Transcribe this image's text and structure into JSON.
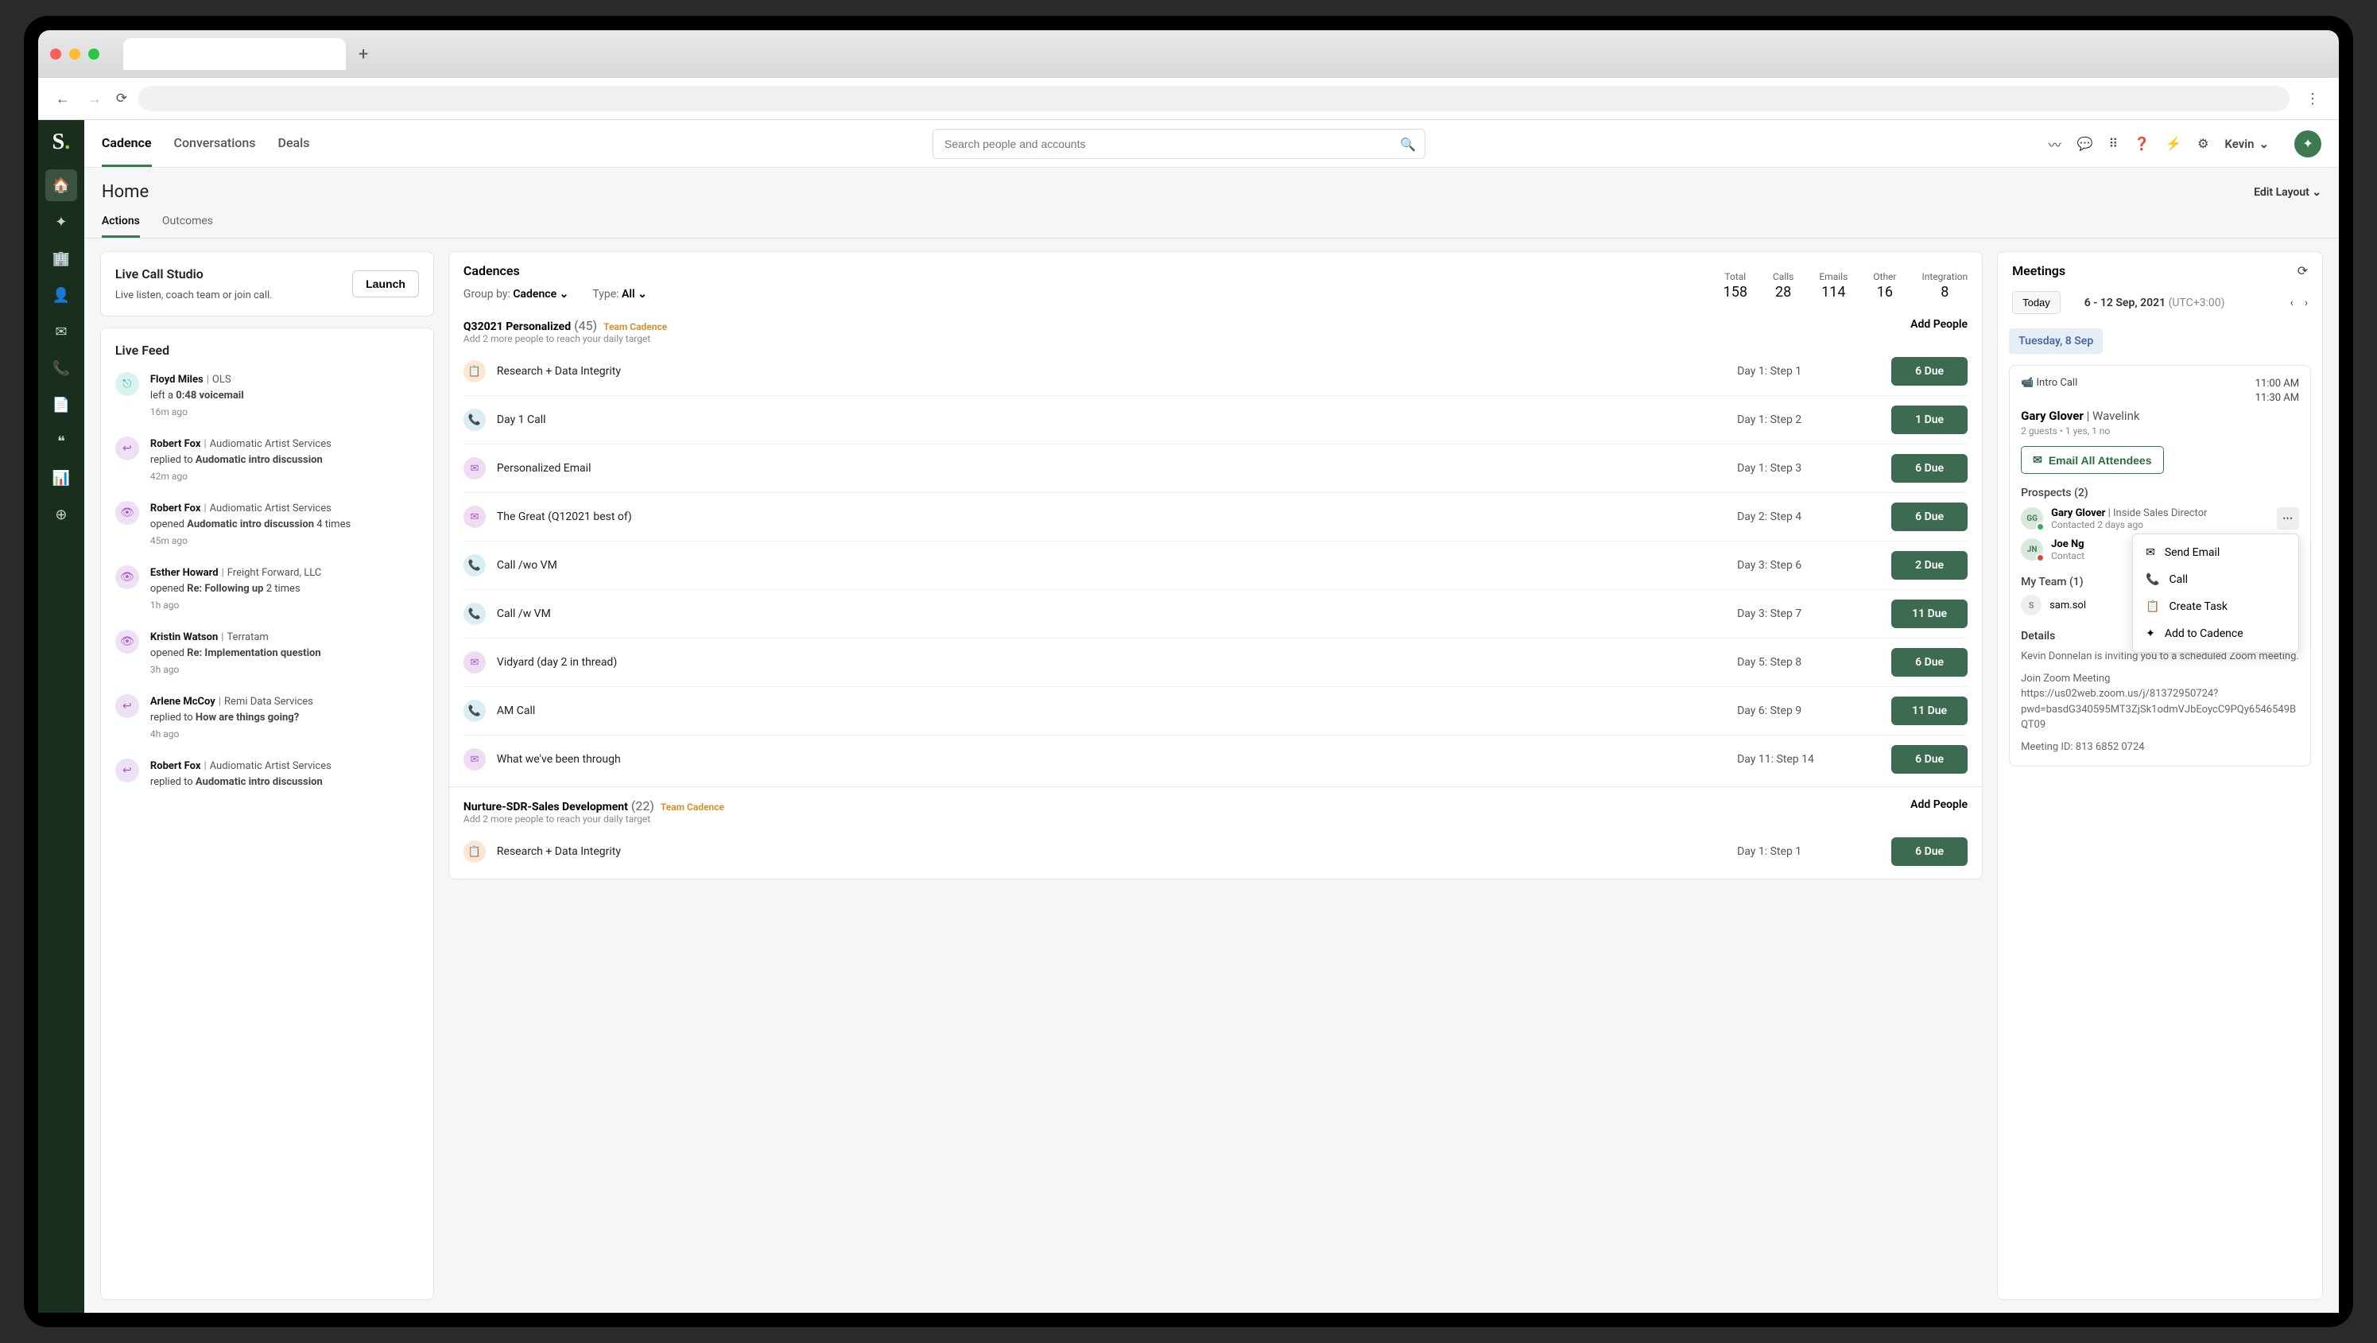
{
  "browser": {
    "new_tab": "+"
  },
  "topNav": {
    "items": [
      "Cadence",
      "Conversations",
      "Deals"
    ],
    "activeIndex": 0
  },
  "search": {
    "placeholder": "Search people and accounts"
  },
  "user": {
    "name": "Kevin"
  },
  "page": {
    "title": "Home",
    "editLayout": "Edit Layout"
  },
  "tabs": {
    "items": [
      "Actions",
      "Outcomes"
    ],
    "activeIndex": 0
  },
  "liveCall": {
    "title": "Live Call Studio",
    "sub": "Live listen, coach team or join call.",
    "button": "Launch"
  },
  "liveFeed": {
    "title": "Live Feed",
    "items": [
      {
        "icon": "voicemail",
        "name": "Floyd Miles",
        "company": "OLS",
        "action": "left a",
        "bold": "0:48 voicemail",
        "suffix": "",
        "time": "16m ago"
      },
      {
        "icon": "reply",
        "name": "Robert Fox",
        "company": "Audiomatic Artist Services",
        "action": "replied to",
        "bold": "Audomatic intro discussion",
        "suffix": "",
        "time": "42m ago"
      },
      {
        "icon": "view",
        "name": "Robert Fox",
        "company": "Audiomatic Artist Services",
        "action": "opened",
        "bold": "Audomatic intro discussion",
        "suffix": " 4 times",
        "time": "45m ago"
      },
      {
        "icon": "view",
        "name": "Esther Howard",
        "company": "Freight Forward, LLC",
        "action": "opened",
        "bold": "Re: Following up",
        "suffix": " 2 times",
        "time": "1h ago"
      },
      {
        "icon": "view",
        "name": "Kristin Watson",
        "company": "Terratam",
        "action": "opened",
        "bold": "Re: Implementation question",
        "suffix": "",
        "time": "3h ago"
      },
      {
        "icon": "reply",
        "name": "Arlene McCoy",
        "company": "Remi Data Services",
        "action": "replied to",
        "bold": "How are things going?",
        "suffix": "",
        "time": "4h ago"
      },
      {
        "icon": "reply",
        "name": "Robert Fox",
        "company": "Audiomatic Artist Services",
        "action": "replied to",
        "bold": "Audomatic intro discussion",
        "suffix": "",
        "time": ""
      }
    ]
  },
  "cadences": {
    "title": "Cadences",
    "groupBy": {
      "label": "Group by:",
      "value": "Cadence"
    },
    "type": {
      "label": "Type:",
      "value": "All"
    },
    "stats": [
      {
        "label": "Total",
        "value": "158"
      },
      {
        "label": "Calls",
        "value": "28"
      },
      {
        "label": "Emails",
        "value": "114"
      },
      {
        "label": "Other",
        "value": "16"
      },
      {
        "label": "Integration",
        "value": "8"
      }
    ],
    "groups": [
      {
        "name": "Q32021 Personalized",
        "count": "(45)",
        "tag": "Team Cadence",
        "sub": "Add 2 more people to reach your daily target",
        "addPeople": "Add People",
        "steps": [
          {
            "type": "action",
            "name": "Research + Data Integrity",
            "day": "Day 1: Step 1",
            "due": "6 Due"
          },
          {
            "type": "call",
            "name": "Day 1 Call",
            "day": "Day 1: Step 2",
            "due": "1 Due"
          },
          {
            "type": "email",
            "name": "Personalized Email",
            "day": "Day 1: Step 3",
            "due": "6 Due"
          },
          {
            "type": "email",
            "name": "The Great (Q12021 best of)",
            "day": "Day 2: Step 4",
            "due": "6 Due"
          },
          {
            "type": "call",
            "name": "Call /wo VM",
            "day": "Day 3: Step 6",
            "due": "2 Due"
          },
          {
            "type": "call",
            "name": "Call /w VM",
            "day": "Day 3: Step 7",
            "due": "11 Due"
          },
          {
            "type": "email",
            "name": "Vidyard (day 2 in thread)",
            "day": "Day 5: Step 8",
            "due": "6 Due"
          },
          {
            "type": "call",
            "name": "AM Call",
            "day": "Day 6: Step 9",
            "due": "11 Due"
          },
          {
            "type": "email",
            "name": "What we've been through",
            "day": "Day 11: Step 14",
            "due": "6 Due"
          }
        ]
      },
      {
        "name": "Nurture-SDR-Sales Development",
        "count": "(22)",
        "tag": "Team Cadence",
        "sub": "Add 2 more people to reach your daily target",
        "addPeople": "Add People",
        "steps": [
          {
            "type": "action",
            "name": "Research + Data Integrity",
            "day": "Day 1: Step 1",
            "due": "6 Due"
          }
        ]
      }
    ]
  },
  "meetings": {
    "title": "Meetings",
    "today": "Today",
    "range": "6 - 12 Sep, 2021",
    "tz": "(UTC+3:00)",
    "dayLabel": "Tuesday, 8 Sep",
    "card": {
      "title": "Intro Call",
      "contact": "Gary Glover",
      "company": "Wavelink",
      "guests": "2 guests  •  1 yes, 1 no",
      "timeStart": "11:00 AM",
      "timeEnd": "11:30 AM",
      "emailBtn": "Email All Attendees",
      "prospectsLabel": "Prospects (2)",
      "prospects": [
        {
          "initials": "GG",
          "status": "green",
          "name": "Gary Glover",
          "role": "Inside Sales Director",
          "sub": "Contacted 2 days ago",
          "showMenu": true
        },
        {
          "initials": "JN",
          "status": "red",
          "name": "Joe Ng",
          "role": "",
          "sub": "Contact",
          "showMenu": false
        }
      ],
      "contextMenu": [
        {
          "icon": "✉",
          "label": "Send Email"
        },
        {
          "icon": "📞",
          "label": "Call"
        },
        {
          "icon": "📋",
          "label": "Create Task"
        },
        {
          "icon": "✦",
          "label": "Add to Cadence"
        }
      ],
      "teamLabel": "My Team (1)",
      "team": [
        {
          "initials": "S",
          "name": "sam.sol"
        }
      ],
      "detailsLabel": "Details",
      "detailsText1": "Kevin Donnelan is inviting you to a scheduled Zoom meeting.",
      "detailsText2": "Join Zoom Meeting",
      "detailsText3": "https://us02web.zoom.us/j/81372950724?pwd=basdG340595MT3ZjSk1odmVJbEoycC9PQy6546549BQT09",
      "detailsText4": "Meeting ID: 813 6852 0724"
    }
  },
  "sideNav": [
    "home",
    "rocket",
    "building",
    "person",
    "mail",
    "phone",
    "file",
    "quote",
    "chart",
    "target"
  ]
}
